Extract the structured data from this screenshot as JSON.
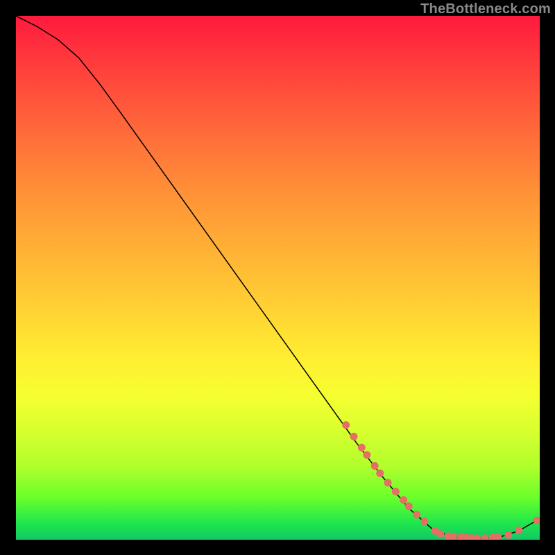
{
  "watermark": "TheBottleneck.com",
  "chart_data": {
    "type": "line",
    "title": "",
    "xlabel": "",
    "ylabel": "",
    "xlim": [
      0,
      100
    ],
    "ylim": [
      0,
      100
    ],
    "grid": false,
    "legend": false,
    "series": [
      {
        "name": "curve",
        "x": [
          0,
          4,
          8,
          12,
          16,
          20,
          25,
          30,
          35,
          40,
          45,
          50,
          55,
          60,
          65,
          70,
          75,
          80,
          84,
          88,
          92,
          96,
          100
        ],
        "y": [
          100,
          98,
          95.5,
          92,
          87,
          81.5,
          74.5,
          67.5,
          60.5,
          53.5,
          46.5,
          39.5,
          32.5,
          25.5,
          18.5,
          12.0,
          6.0,
          1.6,
          0.5,
          0.3,
          0.4,
          1.7,
          4.0
        ]
      }
    ],
    "highlight_points": {
      "x": [
        63,
        64.5,
        66,
        67,
        68.5,
        69.5,
        71,
        72.5,
        74,
        75,
        76.5,
        78,
        80,
        81,
        82.5,
        83.5,
        85,
        86,
        87,
        88,
        89.5,
        91,
        92,
        94,
        96,
        99.5
      ],
      "y": [
        21.9,
        19.7,
        17.6,
        16.2,
        14.1,
        12.7,
        10.9,
        9.2,
        7.6,
        6.4,
        4.8,
        3.5,
        1.7,
        1.1,
        0.7,
        0.6,
        0.5,
        0.4,
        0.3,
        0.3,
        0.3,
        0.4,
        0.5,
        0.9,
        1.8,
        3.7
      ]
    },
    "colors": {
      "line": "#000000",
      "dot": "#e46f64",
      "gradient_top": "#ff1a3e",
      "gradient_bottom": "#13c865"
    }
  }
}
